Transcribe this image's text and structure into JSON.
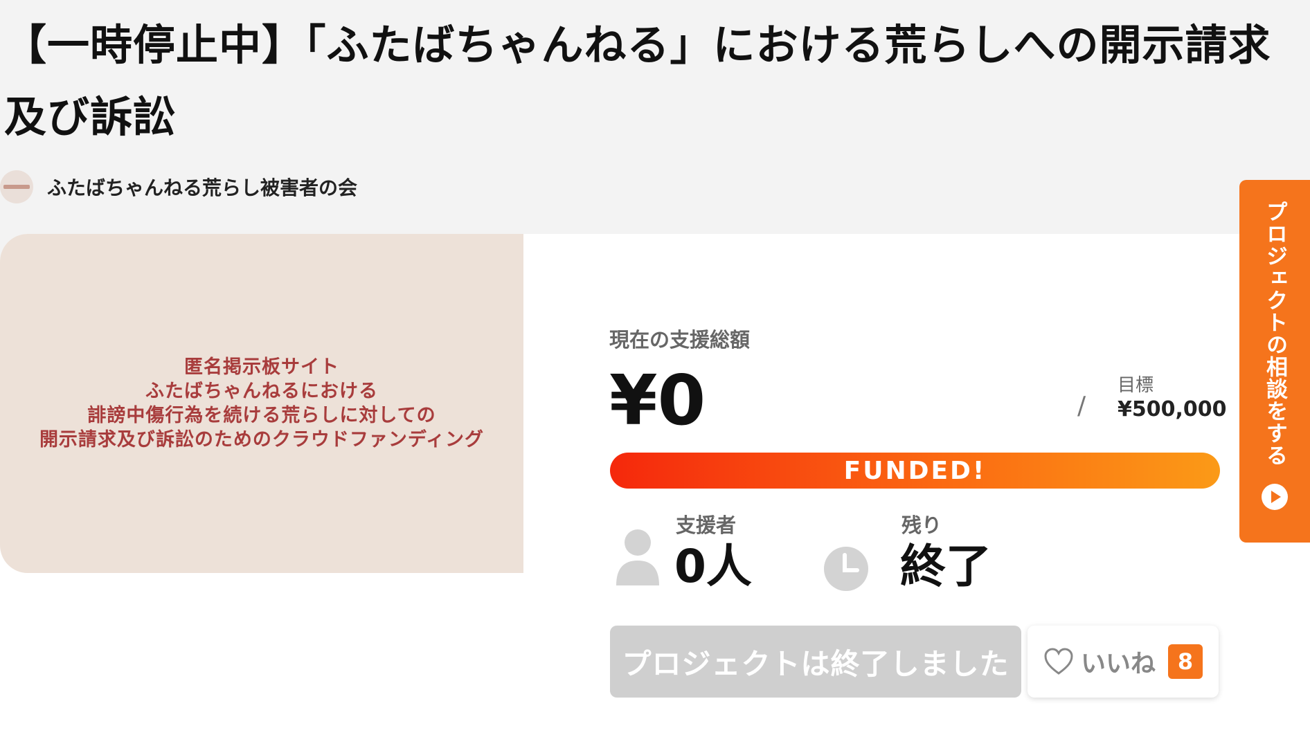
{
  "project": {
    "title": "【一時停止中】「ふたばちゃんねる」における荒らしへの開示請求及び訴訟",
    "owner_name": "ふたばちゃんねる荒らし被害者の会"
  },
  "visual": {
    "lines": [
      "匿名掲示板サイト",
      "ふたばちゃんねるにおける",
      "誹謗中傷行為を続ける荒らしに対しての",
      "開示請求及び訴訟のためのクラウドファンディング"
    ]
  },
  "funding": {
    "current_label": "現在の支援総額",
    "current_amount": "¥0",
    "separator": "/",
    "goal_label": "目標",
    "goal_amount": "¥500,000",
    "progress_text": "FUNDED!",
    "progress_fraction": 1.0,
    "progress_color_start": "#f5280c",
    "progress_color_end": "#fb9a17"
  },
  "stats": {
    "backers_label": "支援者",
    "backers_value": "0人",
    "remaining_label": "残り",
    "remaining_value": "終了",
    "backers_icon": "person-icon",
    "remaining_icon": "clock-icon"
  },
  "actions": {
    "ended_label": "プロジェクトは終了しました",
    "like_label": "いいね",
    "like_count": "8",
    "like_icon": "heart-icon"
  },
  "side_tab": {
    "label": "プロジェクトの相談をする",
    "icon": "play-circle-icon",
    "color": "#f5741c"
  }
}
